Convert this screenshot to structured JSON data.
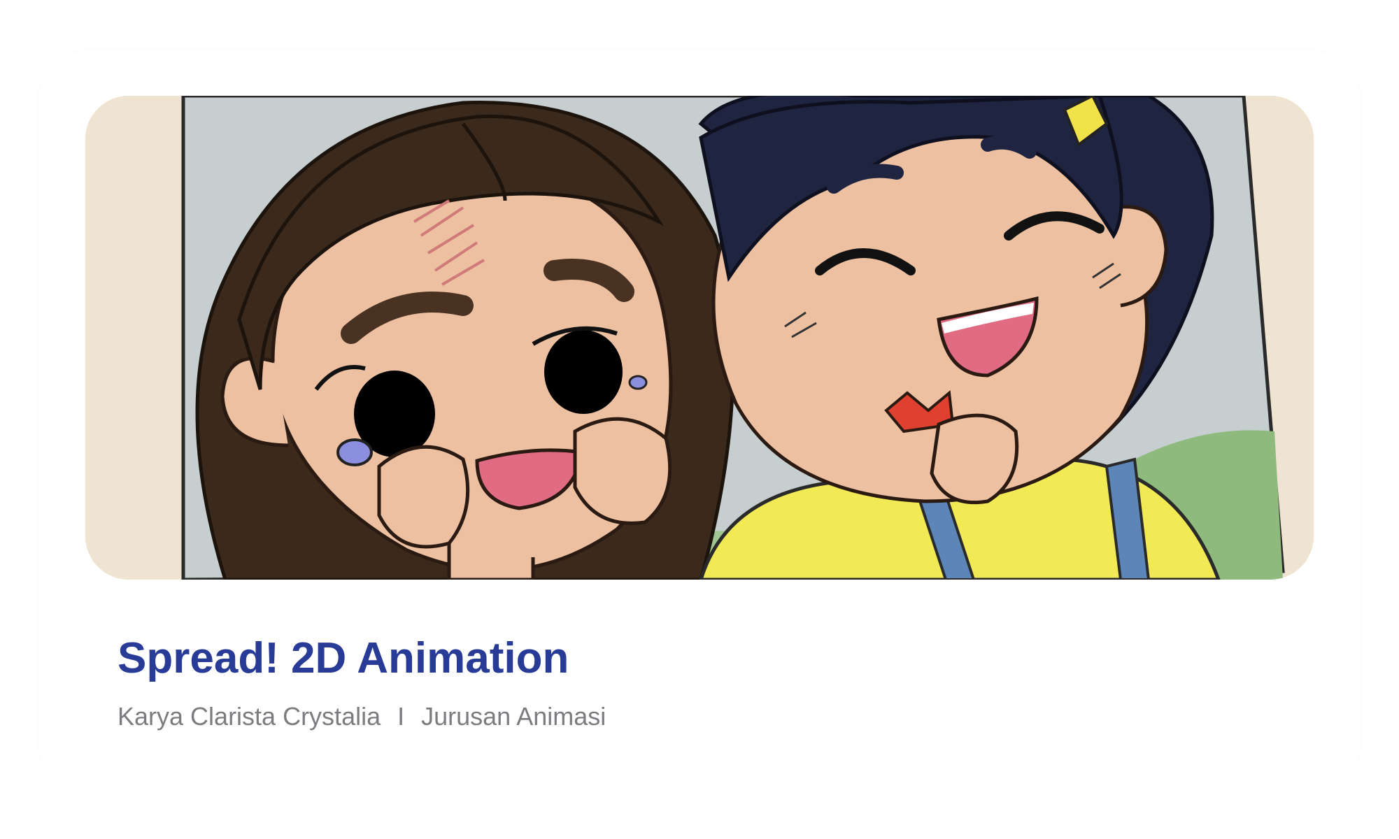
{
  "card": {
    "title": "Spread! 2D Animation",
    "author": "Karya Clarista Crystalia",
    "separator": "I",
    "department": "Jurusan Animasi",
    "thumbnail_subject": "two-cartoon-characters-illustration"
  },
  "colors": {
    "title": "#273b97",
    "meta": "#7b7b80",
    "skin": "#ecc0a0",
    "brown_hair": "#3b2a1c",
    "navy_hair": "#1f2440",
    "shirt_yellow": "#f2ea55",
    "strap_blue": "#5c86b8",
    "window_grey": "#c9d1d2",
    "wall_cream": "#efe4d1"
  }
}
